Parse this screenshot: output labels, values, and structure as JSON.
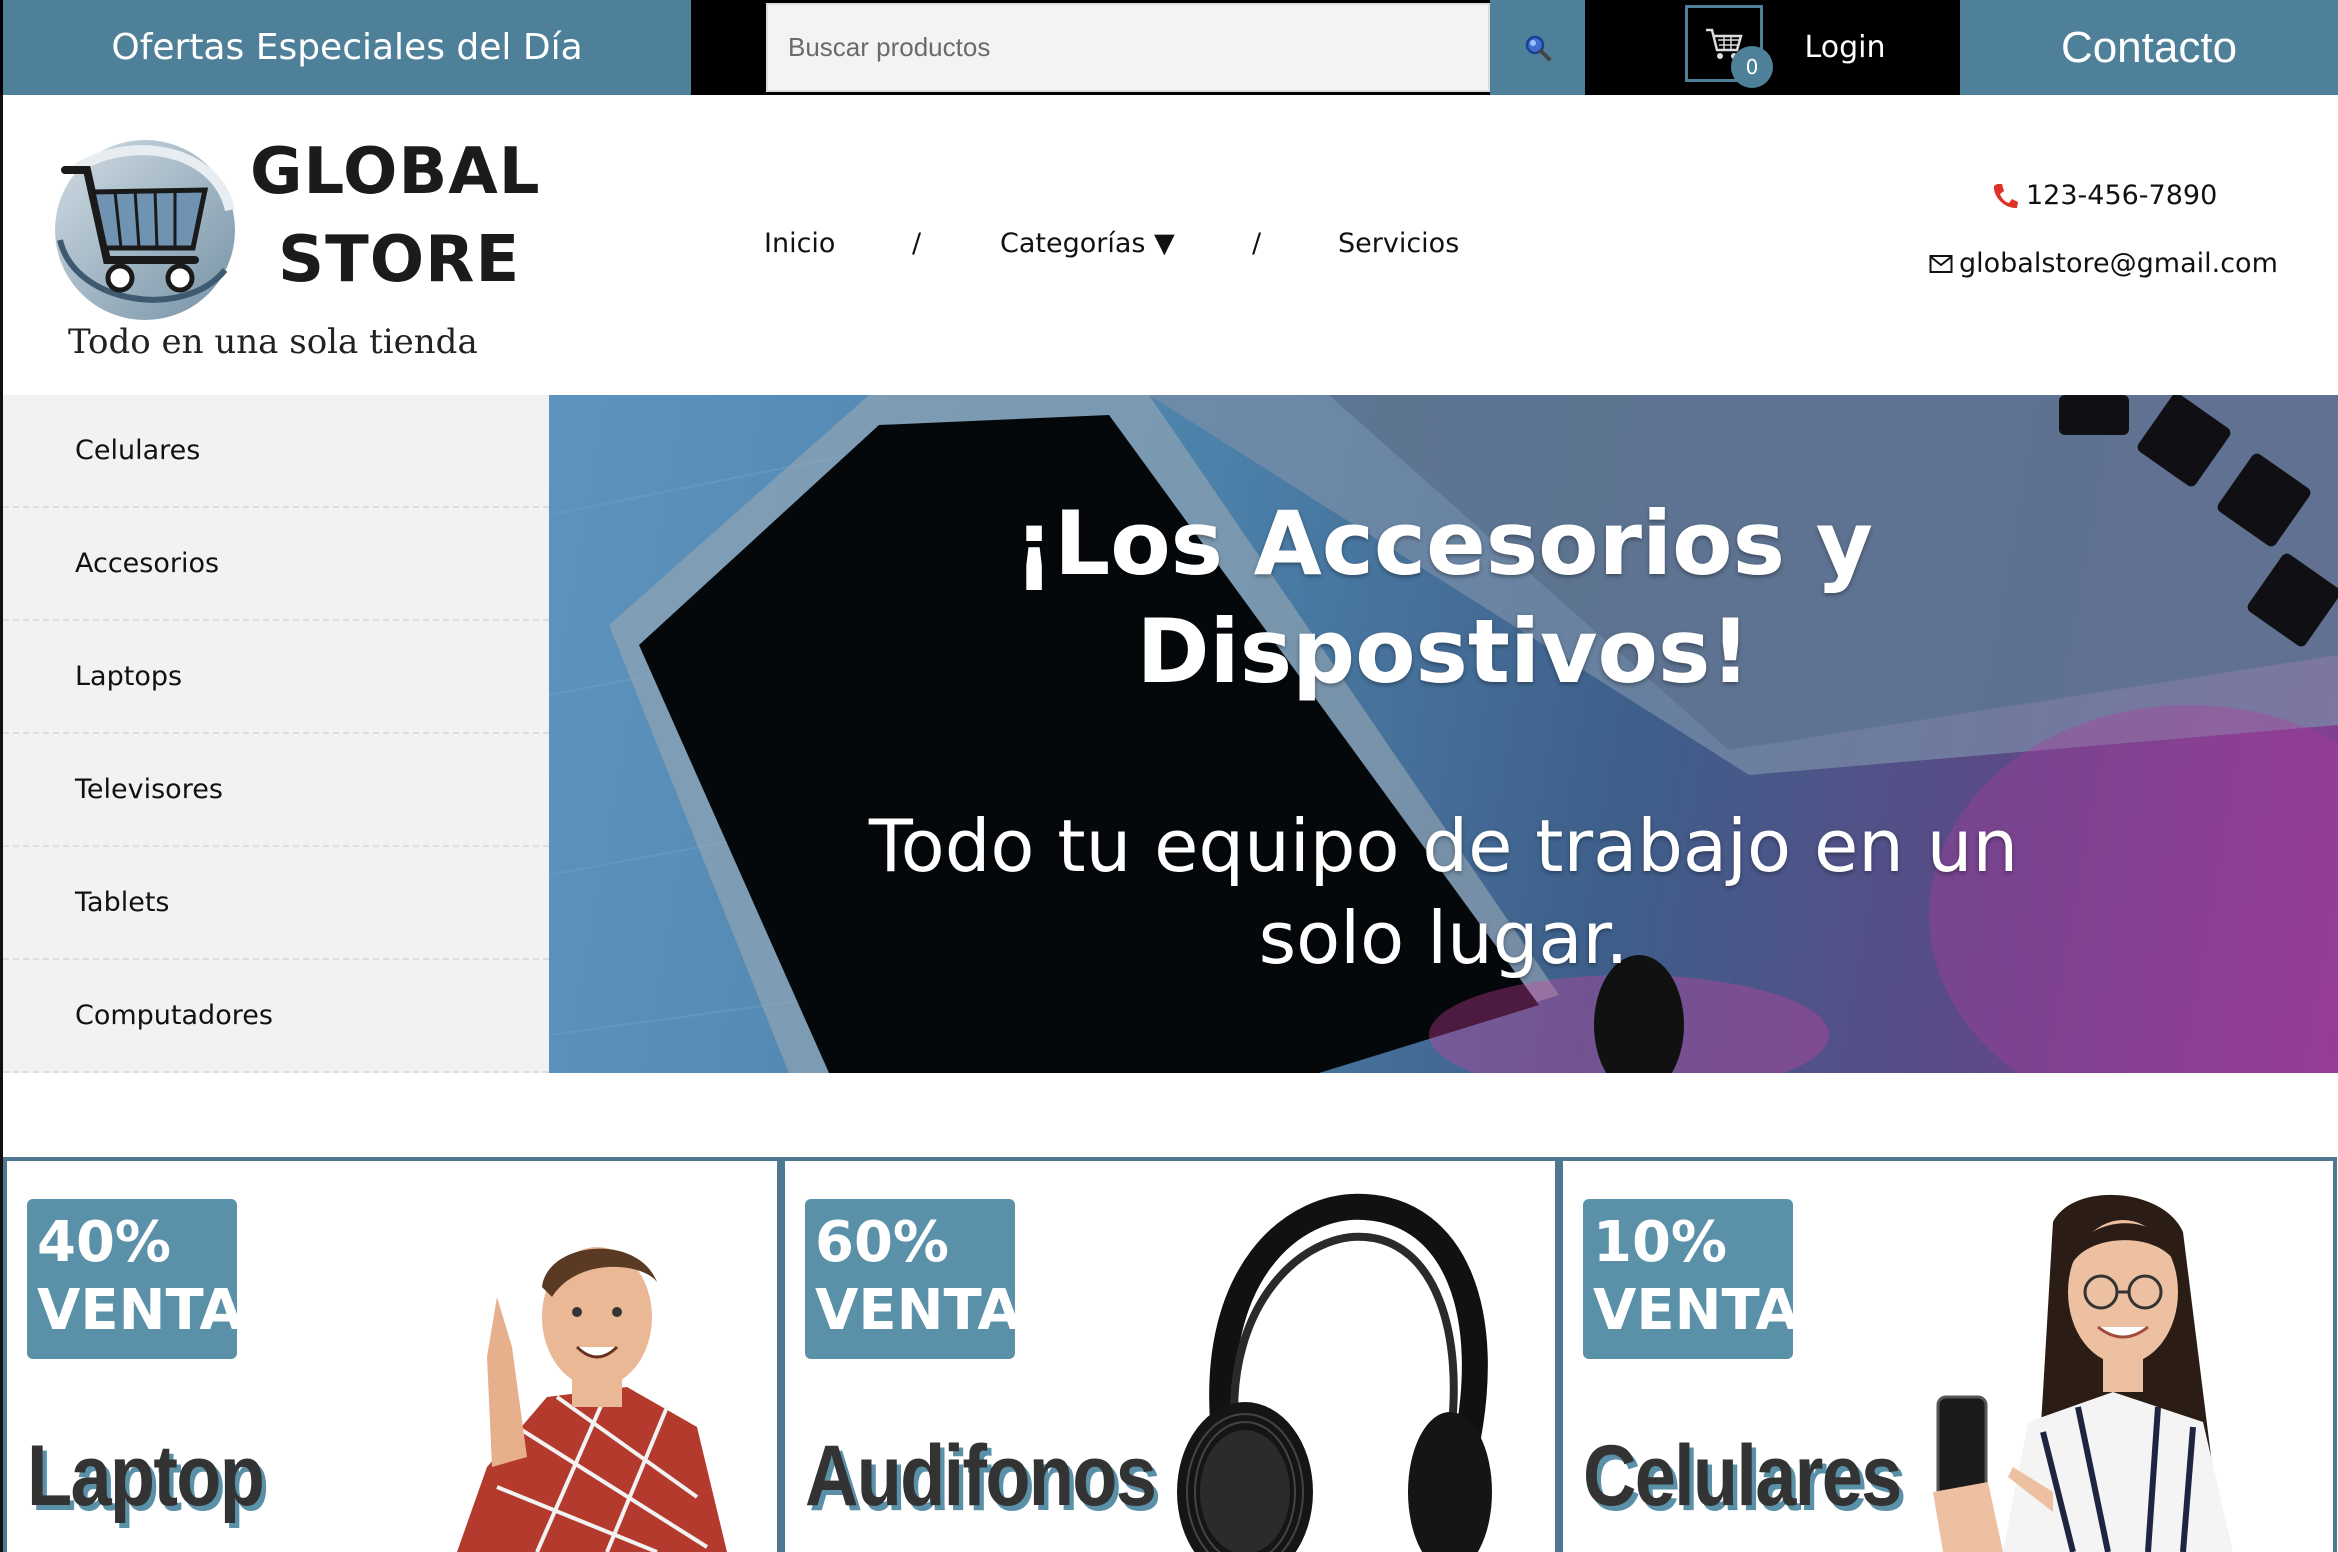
{
  "topbar": {
    "promo_label": "Ofertas Especiales del Día",
    "search_placeholder": "Buscar productos",
    "search_icon": "search-icon",
    "cart_icon": "cart-icon",
    "cart_count": "0",
    "login_label": "Login",
    "contact_label": "Contacto"
  },
  "brand": {
    "name_line1": "GLOBAL",
    "name_line2": "STORE",
    "tagline": "Todo en una sola tienda"
  },
  "nav": {
    "items": [
      "Inicio",
      "Categorías ▼",
      "Servicios"
    ],
    "separator": "/"
  },
  "contact_info": {
    "phone": "123-456-7890",
    "email": "globalstore@gmail.com"
  },
  "sidebar": {
    "items": [
      "Celulares",
      "Accesorios",
      "Laptops",
      "Televisores",
      "Tablets",
      "Computadores"
    ]
  },
  "hero": {
    "title_line1": "¡Los Accesorios y",
    "title_line2": "Dispostivos!",
    "subtitle_line1": "Todo tu equipo de trabajo en un",
    "subtitle_line2": "solo lugar."
  },
  "cards": [
    {
      "badge_pct": "40%",
      "badge_text": "VENTA",
      "title": "Laptop"
    },
    {
      "badge_pct": "60%",
      "badge_text": "VENTA",
      "title": "Audifonos"
    },
    {
      "badge_pct": "10%",
      "badge_text": "VENTA",
      "title": "Celulares"
    }
  ],
  "colors": {
    "accent": "#4e8199",
    "badge": "#5a90a8",
    "topbar_bg": "#000000",
    "sidebar_bg": "#f2f2f2"
  }
}
